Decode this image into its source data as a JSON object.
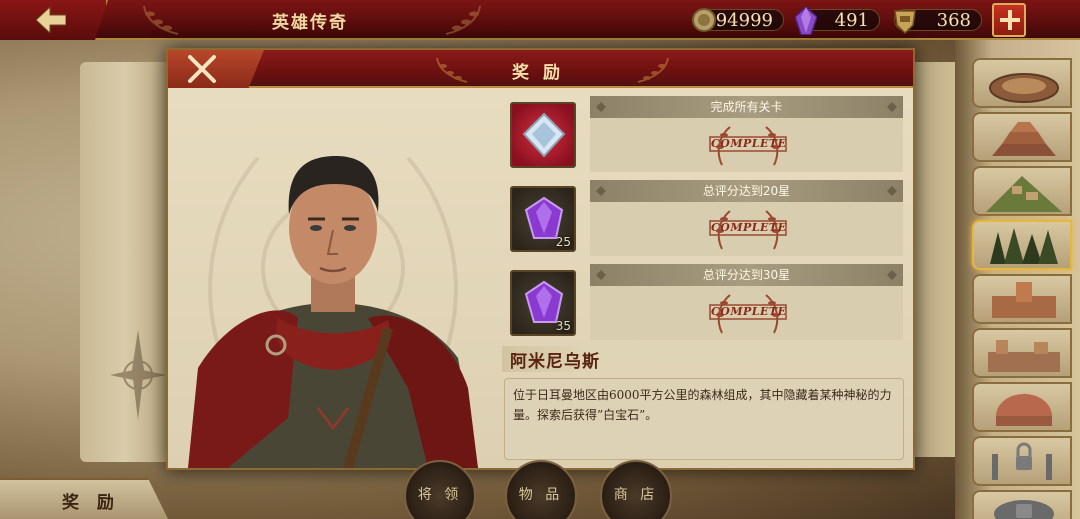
{
  "top_bar": {
    "title": "英雄传奇",
    "coins": "94999",
    "gems": "491",
    "medals": "368"
  },
  "modal": {
    "title": "奖 励",
    "rewards": [
      {
        "condition": "完成所有关卡",
        "icon": "diamond-gem-icon",
        "count": "",
        "status": "COMPLETE"
      },
      {
        "condition": "总评分达到20星",
        "icon": "purple-crystal-icon",
        "count": "25",
        "status": "COMPLETE"
      },
      {
        "condition": "总评分达到30星",
        "icon": "purple-crystal-icon",
        "count": "35",
        "status": "COMPLETE"
      }
    ],
    "hero_name": "阿米尼乌斯",
    "description": "位于日耳曼地区由6000平方公里的森林组成，其中隐藏着某种神秘的力量。探索后获得”白宝石”。"
  },
  "bottom": {
    "active_tab": "奖 励",
    "nav": [
      "将 领",
      "物 品",
      "商 店"
    ]
  },
  "sidebar": {
    "items": [
      "colosseum-icon",
      "ziggurat-icon",
      "hill-town-icon",
      "forest-icon",
      "fortress-icon",
      "walled-city-icon",
      "pantheon-icon",
      "locked-ruins-icon",
      "locked-arena-icon"
    ],
    "active_index": 3
  },
  "colors": {
    "header_red": "#7d1414",
    "gold_trim": "#b08a3a",
    "parchment": "#e9dfc6"
  }
}
